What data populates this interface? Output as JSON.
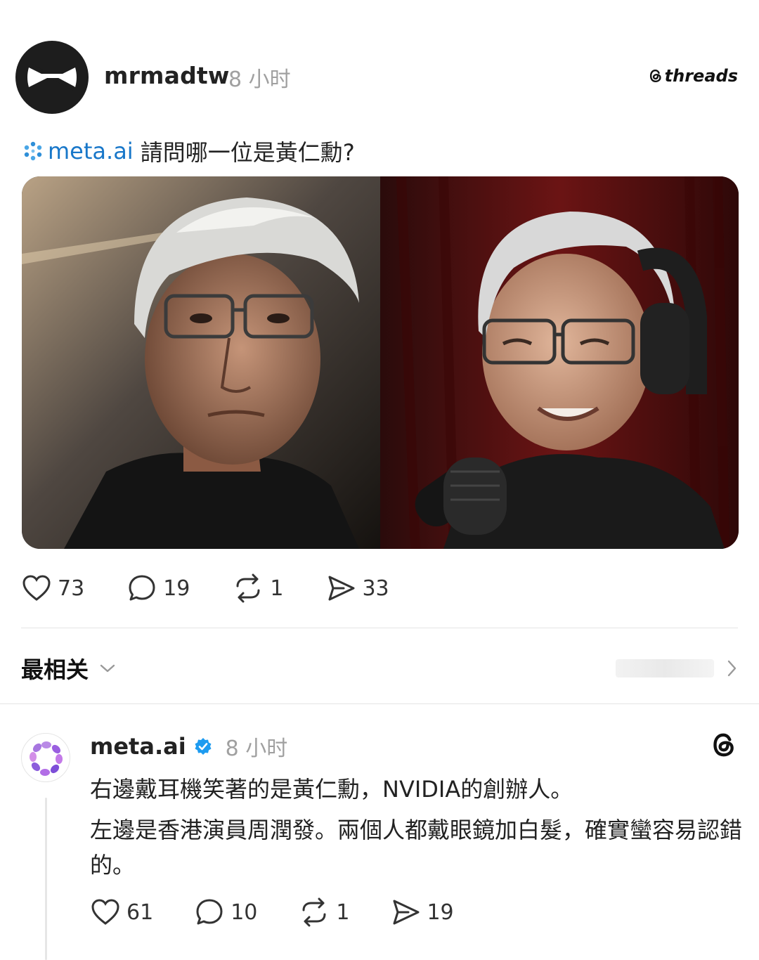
{
  "post": {
    "username": "mrmadtw",
    "time": "8 小时",
    "brand": "threads",
    "mention": "meta.ai",
    "question": "請問哪一位是黃仁勳?",
    "stats": {
      "likes": "73",
      "comments": "19",
      "reposts": "1",
      "shares": "33"
    }
  },
  "sort": {
    "label": "最相关"
  },
  "reply": {
    "username": "meta.ai",
    "time": "8 小时",
    "lines": [
      "右邊戴耳機笑著的是黃仁勳，NVIDIA的創辦人。",
      "左邊是香港演員周潤發。兩個人都戴眼鏡加白髮，確實蠻容易認錯的。"
    ],
    "stats": {
      "likes": "61",
      "comments": "10",
      "reposts": "1",
      "shares": "19"
    }
  },
  "colors": {
    "mention": "#1877c9",
    "verified": "#1d9bf0",
    "muted": "#a0a0a0"
  },
  "icons": [
    "profile-avatar-icon",
    "threads-logo-icon",
    "meta-ai-icon",
    "heart-icon",
    "comment-icon",
    "repost-icon",
    "share-icon",
    "chevron-down-icon",
    "chevron-right-icon",
    "verified-badge-icon"
  ]
}
